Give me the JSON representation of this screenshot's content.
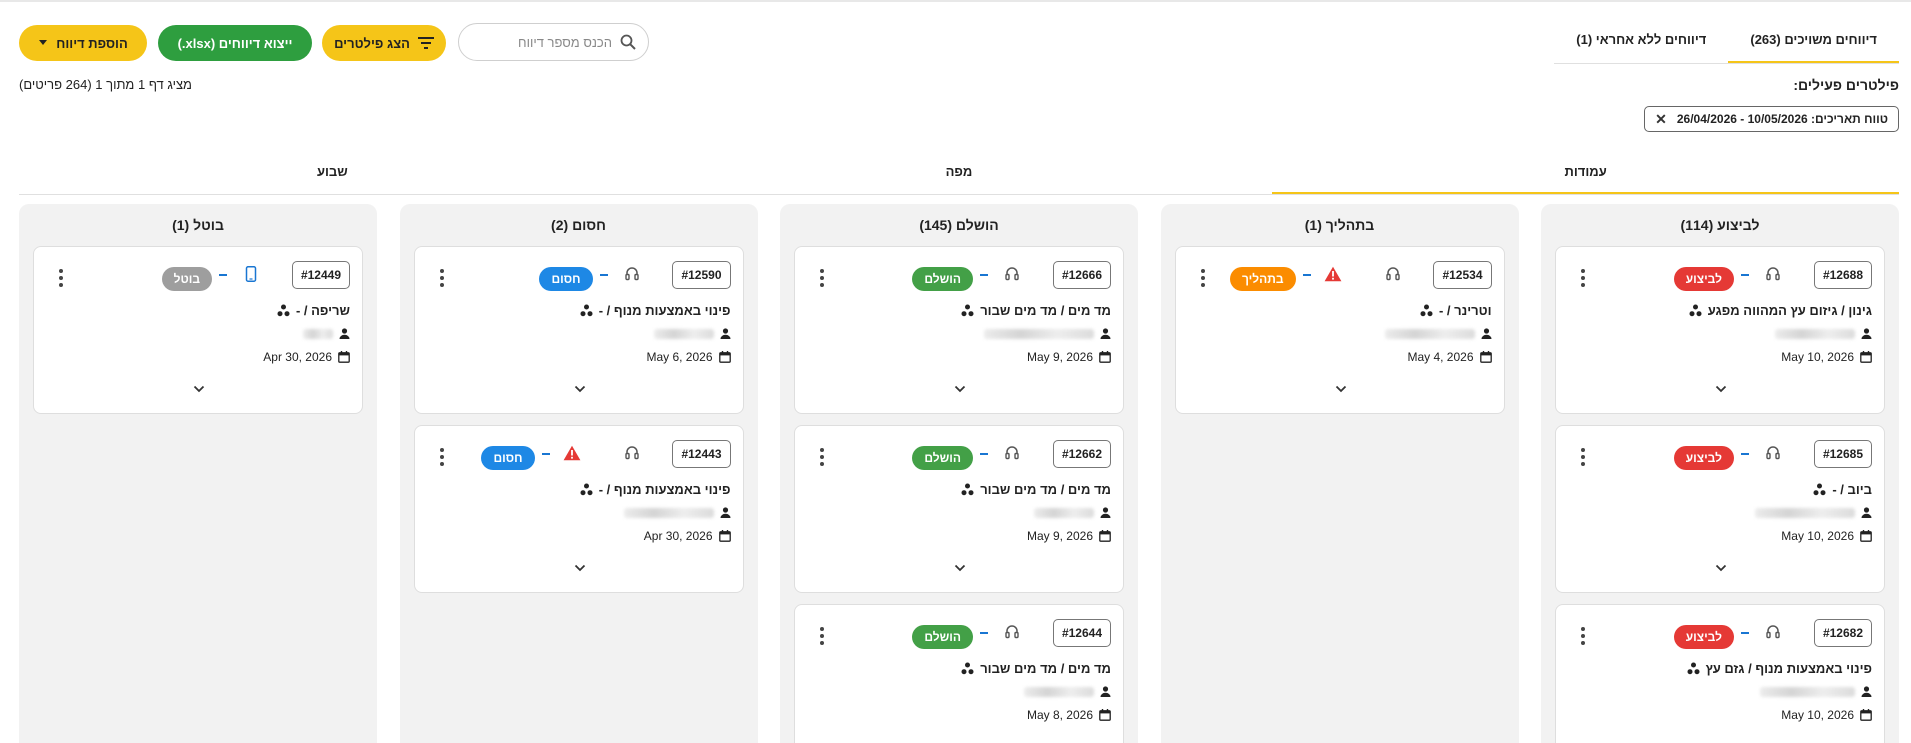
{
  "top_tabs": [
    {
      "label": "דיווחים משויכים (263)",
      "active": true
    },
    {
      "label": "דיווחים ללא אחראי (1)",
      "active": false
    }
  ],
  "toolbar": {
    "add_report": "הוספת דיווח",
    "export": "ייצוא דיווחים (xlsx.)",
    "show_filters": "הצג פילטרים",
    "search_placeholder": "הכנס מספר דיווח"
  },
  "filters": {
    "title": "פילטרים פעילים:",
    "chip": "טווח תאריכים: 10/05/2026 - 26/04/2026"
  },
  "page_info": "מציג דף 1 מתוך 1 (264 פריטים)",
  "view_tabs": [
    {
      "label": "עמודות",
      "active": true
    },
    {
      "label": "מפה",
      "active": false
    },
    {
      "label": "שבוע",
      "active": false
    }
  ],
  "columns": [
    {
      "title": "לביצוע (114)",
      "cards": [
        {
          "id": "#12688",
          "status": "לביצוע",
          "status_color": "#e53935",
          "warning": false,
          "device": "headset",
          "title": "גינון / גיזום עץ המהווה מפגע",
          "date": "May 10, 2026"
        },
        {
          "id": "#12685",
          "status": "לביצוע",
          "status_color": "#e53935",
          "warning": false,
          "device": "headset",
          "title": "ביוב / -",
          "date": "May 10, 2026"
        },
        {
          "id": "#12682",
          "status": "לביצוע",
          "status_color": "#e53935",
          "warning": false,
          "device": "headset",
          "title": "פינוי באמצעות מנוף / גזם עץ",
          "date": "May 10, 2026"
        }
      ]
    },
    {
      "title": "בתהליך (1)",
      "cards": [
        {
          "id": "#12534",
          "status": "בתהליך",
          "status_color": "#fb8c00",
          "warning": true,
          "device": "headset",
          "title": "וטרינר / -",
          "date": "May 4, 2026"
        }
      ]
    },
    {
      "title": "הושלם (145)",
      "cards": [
        {
          "id": "#12666",
          "status": "הושלם",
          "status_color": "#43a047",
          "warning": false,
          "device": "headset",
          "title": "מד מים / מד מים שבור",
          "date": "May 9, 2026"
        },
        {
          "id": "#12662",
          "status": "הושלם",
          "status_color": "#43a047",
          "warning": false,
          "device": "headset",
          "title": "מד מים / מד מים שבור",
          "date": "May 9, 2026"
        },
        {
          "id": "#12644",
          "status": "הושלם",
          "status_color": "#43a047",
          "warning": false,
          "device": "headset",
          "title": "מד מים / מד מים שבור",
          "date": "May 8, 2026"
        }
      ]
    },
    {
      "title": "חסום (2)",
      "cards": [
        {
          "id": "#12590",
          "status": "חסום",
          "status_color": "#1e88e5",
          "warning": false,
          "device": "headset",
          "title": "פינוי באמצעות מנוף / -",
          "date": "May 6, 2026"
        },
        {
          "id": "#12443",
          "status": "חסום",
          "status_color": "#1e88e5",
          "warning": true,
          "device": "headset",
          "title": "פינוי באמצעות מנוף / -",
          "date": "Apr 30, 2026"
        }
      ]
    },
    {
      "title": "בוטל (1)",
      "cards": [
        {
          "id": "#12449",
          "status": "בוטל",
          "status_color": "#9e9e9e",
          "warning": false,
          "device": "phone",
          "title": "שריפה / -",
          "date": "Apr 30, 2026"
        }
      ]
    }
  ]
}
